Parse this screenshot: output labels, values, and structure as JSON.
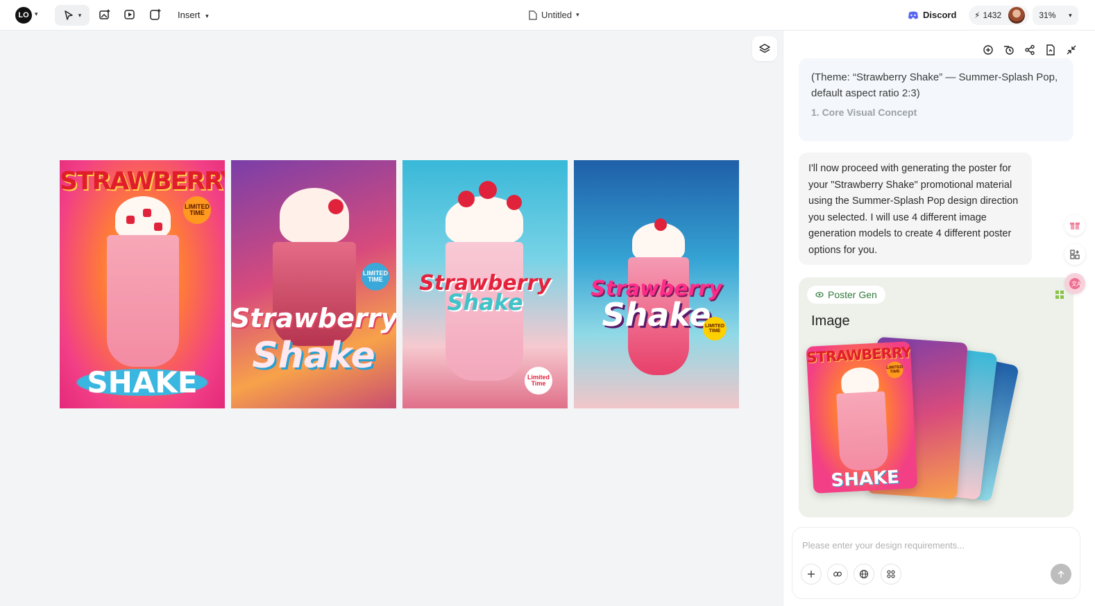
{
  "topbar": {
    "logo_text": "LO",
    "insert_label": "Insert",
    "doc_title": "Untitled",
    "discord_label": "Discord",
    "credits": "1432",
    "zoom": "31%"
  },
  "posters": [
    {
      "title_top": "STRAWBERRY",
      "title_bottom": "SHAKE",
      "badge": "LIMITED TIME"
    },
    {
      "title_top": "Strawberry",
      "title_bottom": "Shake",
      "badge": "LIMITED TIME"
    },
    {
      "title_top": "Strawberry",
      "title_bottom": "Shake",
      "badge": "Limited Time"
    },
    {
      "title_top": "Strawberry",
      "title_bottom": "Shake",
      "badge": "LIMITED TIME"
    }
  ],
  "chat": {
    "msg1_text": "(Theme: “Strawberry Shake” — Summer-Splash Pop, default aspect ratio 2:3)",
    "msg1_sub": "1. Core Visual Concept",
    "msg2_text": "I'll now proceed with generating the poster for your \"Strawberry Shake\" promotional material using the Summer-Splash Pop design direction you selected. I will use 4 different image generation models to create 4 different poster options for you.",
    "gen_tag": "Poster Gen",
    "gen_title": "Image",
    "stack_title_top": "STRAWBERRY",
    "stack_title_bottom": "SHAKE",
    "stack_badge": "LIMITED TIME",
    "input_placeholder": "Please enter your design requirements..."
  }
}
